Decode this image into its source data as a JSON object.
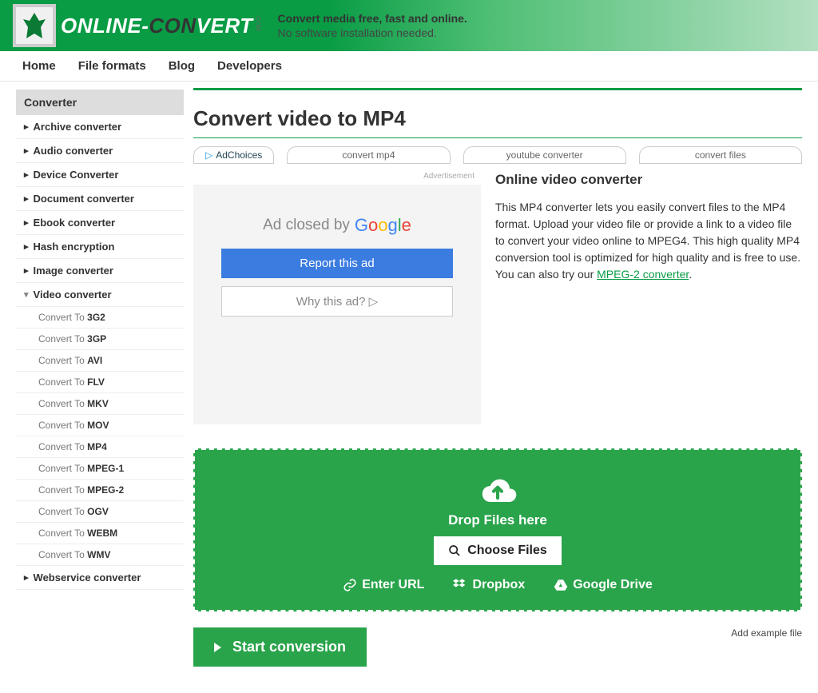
{
  "header": {
    "logo_text_1": "ONLINE-",
    "logo_text_2": "CON",
    "logo_text_3": "VERT",
    "logo_suffix": ".COM",
    "tagline_bold": "Convert media free, fast and online.",
    "tagline_sub": "No software installation needed."
  },
  "nav": [
    "Home",
    "File formats",
    "Blog",
    "Developers"
  ],
  "sidebar": {
    "header": "Converter",
    "categories": [
      {
        "label": "Archive converter",
        "open": false
      },
      {
        "label": "Audio converter",
        "open": false
      },
      {
        "label": "Device Converter",
        "open": false
      },
      {
        "label": "Document converter",
        "open": false
      },
      {
        "label": "Ebook converter",
        "open": false
      },
      {
        "label": "Hash encryption",
        "open": false
      },
      {
        "label": "Image converter",
        "open": false
      },
      {
        "label": "Video converter",
        "open": true
      },
      {
        "label": "Webservice converter",
        "open": false
      }
    ],
    "sub_prefix": "Convert To ",
    "video_formats": [
      "3G2",
      "3GP",
      "AVI",
      "FLV",
      "MKV",
      "MOV",
      "MP4",
      "MPEG-1",
      "MPEG-2",
      "OGV",
      "WEBM",
      "WMV"
    ]
  },
  "main": {
    "title": "Convert video to MP4",
    "adchoices": "AdChoices",
    "adlinks": [
      "convert mp4",
      "youtube converter",
      "convert files"
    ],
    "ad": {
      "label": "Advertisement",
      "closed_text": "Ad closed by",
      "google": "Google",
      "report": "Report this ad",
      "why": "Why this ad? ▷"
    },
    "desc": {
      "heading": "Online video converter",
      "body": "This MP4 converter lets you easily convert files to the MP4 format. Upload your video file or provide a link to a video file to convert your video online to MPEG4. This high quality MP4 conversion tool is optimized for high quality and is free to use. You can also try our ",
      "link_text": "MPEG-2 converter",
      "after_link": "."
    },
    "drop": {
      "label": "Drop Files here",
      "choose": "Choose Files",
      "sources": [
        "Enter URL",
        "Dropbox",
        "Google Drive"
      ]
    },
    "start": "Start conversion",
    "example": "Add example file"
  }
}
